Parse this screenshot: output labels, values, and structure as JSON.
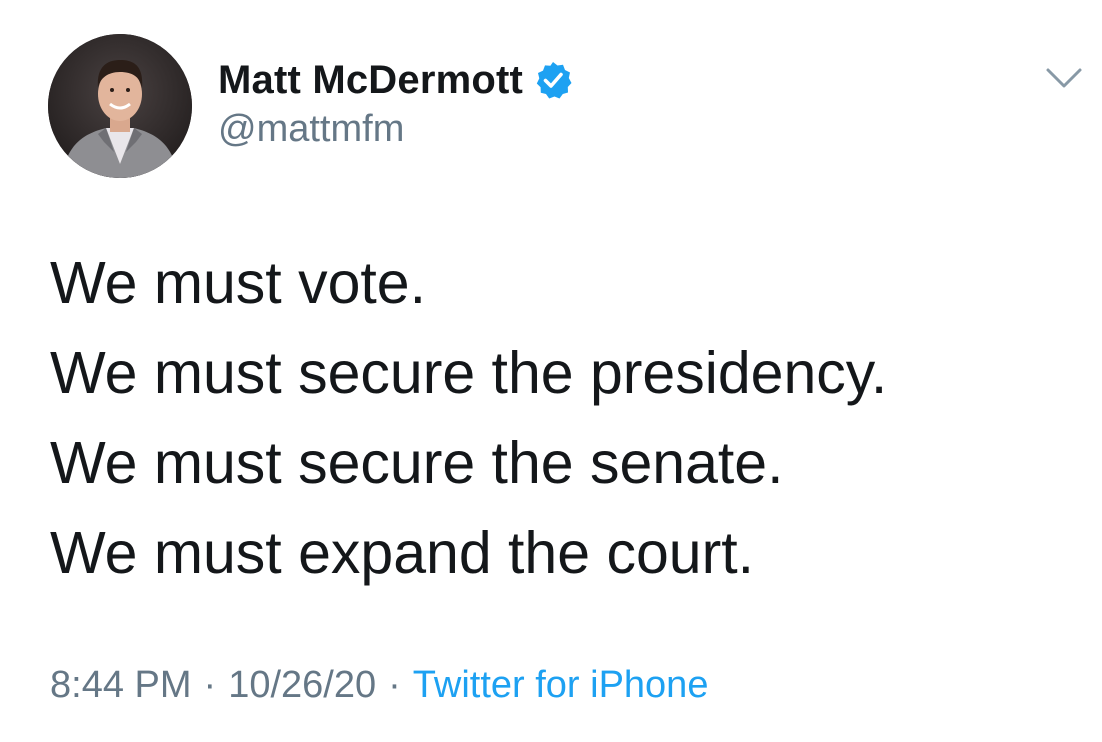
{
  "user": {
    "display_name": "Matt McDermott",
    "handle": "@mattmfm",
    "verified_icon": "verified-badge-icon",
    "avatar_icon": "profile-photo"
  },
  "menu": {
    "icon": "chevron-down-icon"
  },
  "tweet": {
    "lines": [
      "We must vote.",
      "We must secure the presidency.",
      "We must secure the senate.",
      "We must expand the court."
    ]
  },
  "meta": {
    "time": "8:44 PM",
    "separator": "·",
    "date": "10/26/20",
    "source": "Twitter for iPhone"
  },
  "colors": {
    "text": "#14171a",
    "secondary": "#657786",
    "accent": "#1da1f2"
  }
}
